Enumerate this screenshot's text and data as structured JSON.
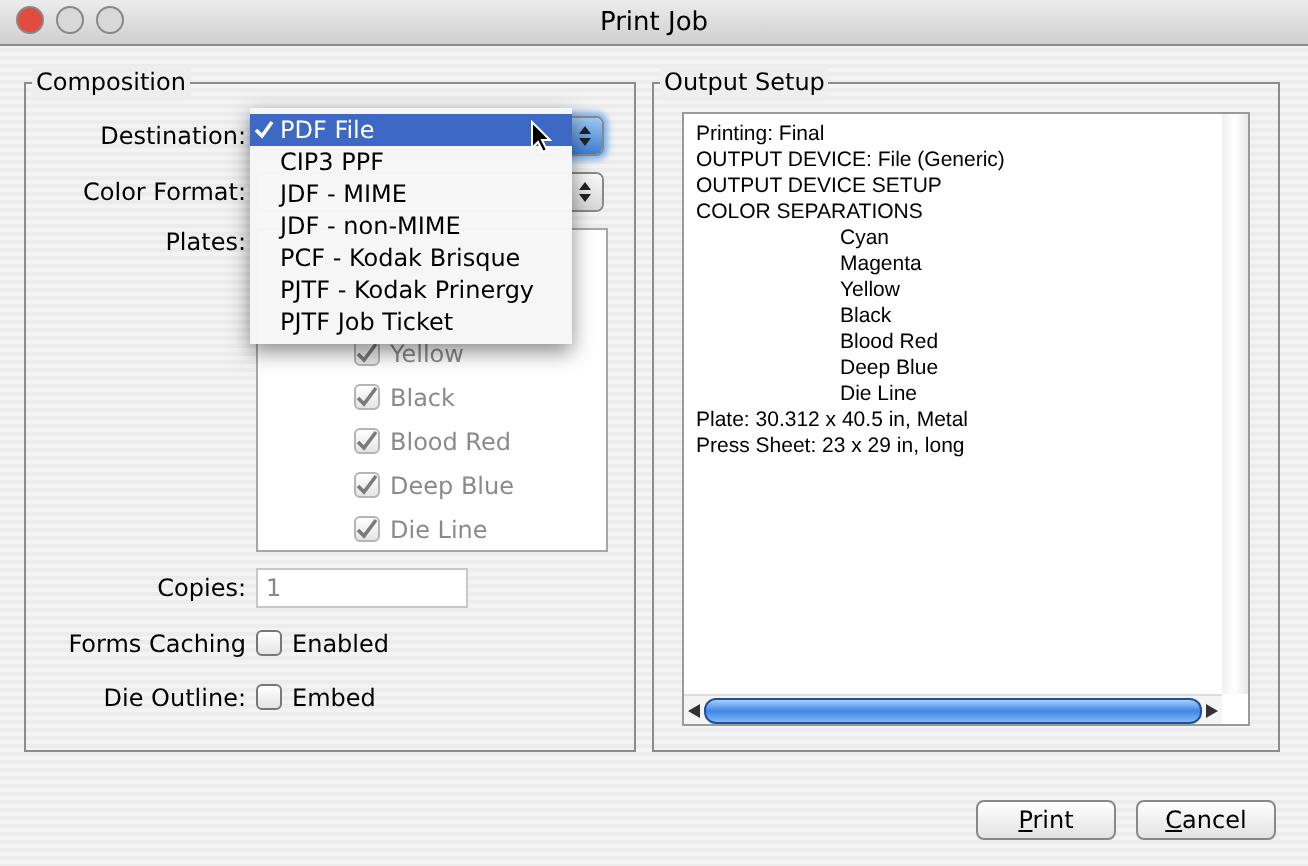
{
  "window": {
    "title": "Print Job"
  },
  "composition": {
    "title": "Composition",
    "destination": {
      "label": "Destination:",
      "menu": [
        {
          "label": "PDF File",
          "selected": true
        },
        {
          "label": "CIP3 PPF",
          "selected": false
        },
        {
          "label": "JDF - MIME",
          "selected": false
        },
        {
          "label": "JDF - non-MIME",
          "selected": false
        },
        {
          "label": "PCF - Kodak Brisque",
          "selected": false
        },
        {
          "label": "PJTF - Kodak Prinergy",
          "selected": false
        },
        {
          "label": "PJTF Job Ticket",
          "selected": false
        }
      ]
    },
    "color_format": {
      "label": "Color Format:"
    },
    "plates": {
      "label": "Plates:",
      "items": [
        {
          "label": "Yellow",
          "checked": true,
          "disabled": true
        },
        {
          "label": "Black",
          "checked": true,
          "disabled": true
        },
        {
          "label": "Blood Red",
          "checked": true,
          "disabled": true
        },
        {
          "label": "Deep Blue",
          "checked": true,
          "disabled": true
        },
        {
          "label": "Die Line",
          "checked": true,
          "disabled": true
        }
      ]
    },
    "copies": {
      "label": "Copies:",
      "value": "1"
    },
    "options": [
      {
        "label": "Forms Caching",
        "option": "Enabled",
        "checked": false
      },
      {
        "label": "Die Outline:",
        "option": "Embed",
        "checked": false
      }
    ]
  },
  "output_setup": {
    "title": "Output Setup",
    "lines": [
      {
        "text": "Printing: Final",
        "indented": false
      },
      {
        "text": "OUTPUT DEVICE: File (Generic)",
        "indented": false
      },
      {
        "text": "OUTPUT DEVICE SETUP",
        "indented": false
      },
      {
        "text": "COLOR SEPARATIONS",
        "indented": false
      },
      {
        "text": "Cyan",
        "indented": true
      },
      {
        "text": "Magenta",
        "indented": true
      },
      {
        "text": "Yellow",
        "indented": true
      },
      {
        "text": "Black",
        "indented": true
      },
      {
        "text": "Blood Red",
        "indented": true
      },
      {
        "text": "Deep Blue",
        "indented": true
      },
      {
        "text": "Die Line",
        "indented": true
      },
      {
        "text": "Plate: 30.312 x 40.5 in, Metal",
        "indented": false
      },
      {
        "text": "Press Sheet: 23 x 29 in, long",
        "indented": false
      }
    ]
  },
  "buttons": [
    "Print",
    "Cancel"
  ]
}
